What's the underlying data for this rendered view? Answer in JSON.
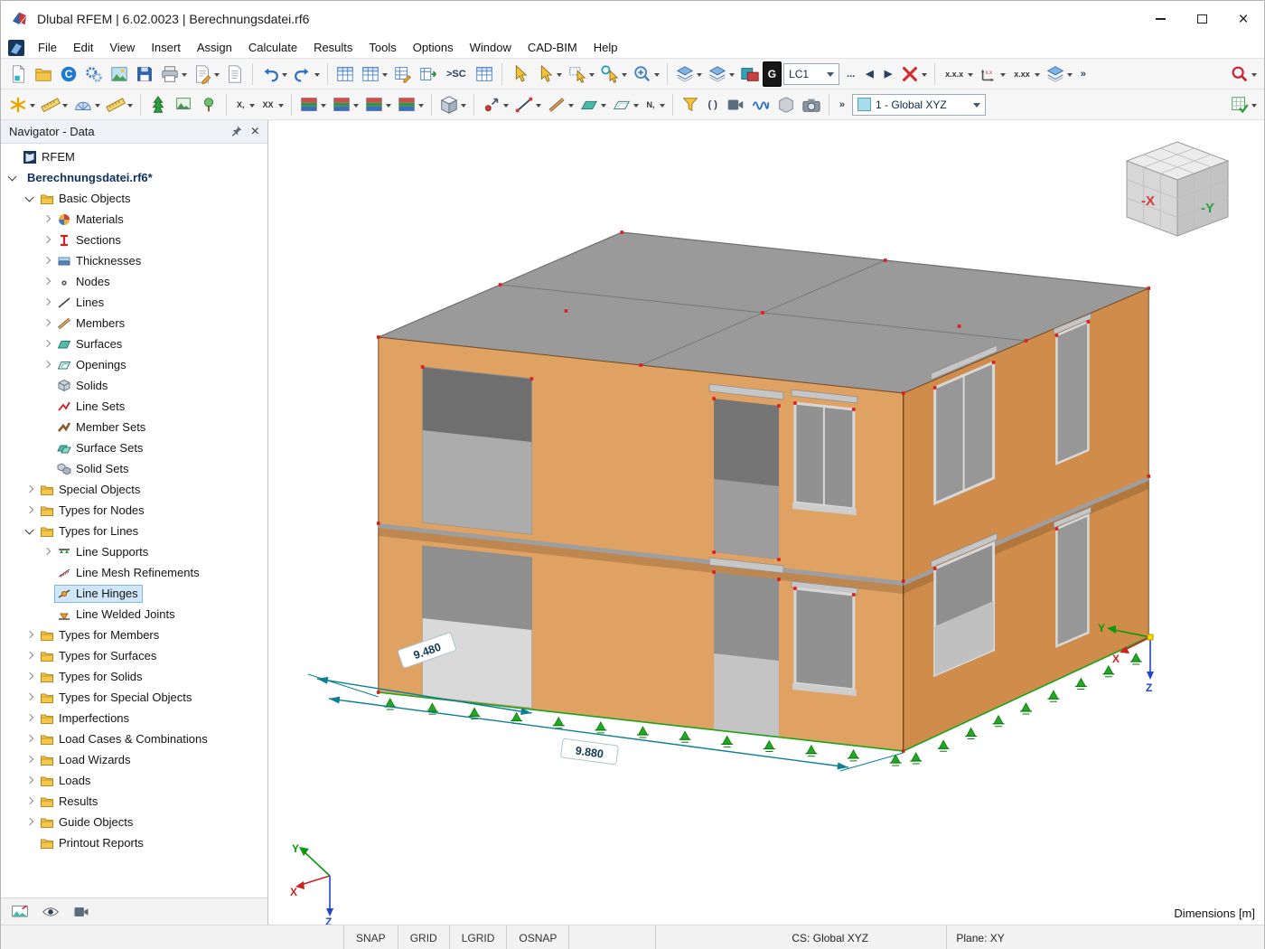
{
  "window": {
    "title": "Dlubal RFEM | 6.02.0023 | Berechnungsdatei.rf6",
    "minimize_glyph": "–",
    "maximize_glyph": "□",
    "close_glyph": "×"
  },
  "menu": {
    "items": [
      "File",
      "Edit",
      "View",
      "Insert",
      "Assign",
      "Calculate",
      "Results",
      "Tools",
      "Options",
      "Window",
      "CAD-BIM",
      "Help"
    ]
  },
  "toolbars": {
    "row1": [
      {
        "name": "new-model-button",
        "icon": "page"
      },
      {
        "name": "open-model-button",
        "icon": "folder"
      },
      {
        "name": "dlubal-center-button",
        "icon": "globec"
      },
      {
        "name": "settings-button",
        "icon": "gears"
      },
      {
        "name": "panel-manager-button",
        "icon": "render"
      },
      {
        "name": "save-button",
        "icon": "floppy"
      },
      {
        "name": "print-button",
        "icon": "printer",
        "dd": 1
      },
      {
        "name": "printout-report-button",
        "icon": "docpen",
        "dd": 1
      },
      {
        "name": "report-button",
        "icon": "doc"
      },
      {
        "sep": 1
      },
      {
        "name": "undo-button",
        "icon": "undo",
        "dd": 1
      },
      {
        "name": "redo-button",
        "icon": "redo",
        "dd": 1
      },
      {
        "sep": 1
      },
      {
        "name": "show-tables-button",
        "icon": "table"
      },
      {
        "name": "table-layout-button",
        "icon": "table",
        "dd": 1
      },
      {
        "name": "edit-table-button",
        "icon": "tablepen"
      },
      {
        "name": "export-table-button",
        "icon": "tablearr"
      },
      {
        "name": "sc-shortcut-button",
        "text": ">SC"
      },
      {
        "name": "table-settings-button",
        "icon": "table"
      },
      {
        "sep": 1
      },
      {
        "name": "select-pointer-button",
        "icon": "cursor"
      },
      {
        "name": "select-special-button",
        "icon": "cursor",
        "dd": 1
      },
      {
        "name": "select-window-button",
        "icon": "cursorwin",
        "dd": 1
      },
      {
        "name": "select-criteria-button",
        "icon": "cursorq",
        "dd": 1
      },
      {
        "name": "zoom-window-button",
        "icon": "magplus",
        "dd": 1
      },
      {
        "sep": 1
      },
      {
        "name": "guide-lines-button",
        "icon": "layers",
        "dd": 1
      },
      {
        "name": "snap-grid-button",
        "icon": "layers",
        "dd": 1
      },
      {
        "name": "partial-view-swatch-button",
        "icon": "swatch"
      },
      {
        "name": "g-grid-toggle-button",
        "text": "G",
        "style": "gbox"
      },
      {
        "name": "load-case-select",
        "select": "LC1",
        "width": 62
      },
      {
        "name": "load-case-browse-button",
        "text": "..."
      },
      {
        "name": "previous-load-case-button",
        "text": "◀"
      },
      {
        "name": "next-load-case-button",
        "text": "▶"
      },
      {
        "name": "delete-loads-button",
        "icon": "xred",
        "dd": 1
      },
      {
        "sep": 1
      },
      {
        "name": "numbering-nodes-button",
        "text": "x.x.x",
        "small": 1,
        "dd": 1
      },
      {
        "name": "numbering-axes-button",
        "icon": "axes",
        "dd": 1
      },
      {
        "name": "numbering-values-button",
        "text": "x.xx",
        "small": 1,
        "dd": 1
      },
      {
        "name": "display-layers-button",
        "icon": "layers",
        "dd": 1
      },
      {
        "name": "toolbar-overflow-1-button",
        "text": "»"
      },
      {
        "spacer": 1
      },
      {
        "name": "find-object-button",
        "icon": "magred",
        "dd": 1
      }
    ],
    "row2": [
      {
        "name": "new-objects-button",
        "icon": "star",
        "dd": 1
      },
      {
        "name": "edit-objects-button",
        "icon": "ruler",
        "dd": 1
      },
      {
        "name": "measure-button",
        "icon": "protract",
        "dd": 1
      },
      {
        "name": "generate-button",
        "icon": "ruler",
        "dd": 1
      },
      {
        "sep": 1
      },
      {
        "name": "guide-objects-button",
        "icon": "tree"
      },
      {
        "name": "background-image-button",
        "icon": "tree2"
      },
      {
        "name": "visual-style-button",
        "icon": "tree3"
      },
      {
        "sep": 1
      },
      {
        "name": "numbering-x-button",
        "text": "X,",
        "small": 1,
        "dd": 1
      },
      {
        "name": "numbering-xx-button",
        "text": "XX",
        "small": 1,
        "dd": 1
      },
      {
        "sep": 1
      },
      {
        "name": "display-results-button",
        "icon": "renderc",
        "dd": 1
      },
      {
        "name": "render-solid-button",
        "icon": "renderc",
        "dd": 1
      },
      {
        "name": "render-transparent-button",
        "icon": "renderc",
        "dd": 1
      },
      {
        "name": "render-wireframe-button",
        "icon": "renderc",
        "dd": 1
      },
      {
        "sep": 1
      },
      {
        "name": "isometric-view-button",
        "icon": "cube",
        "dd": 1
      },
      {
        "sep": 1
      },
      {
        "name": "insert-node-button",
        "icon": "node",
        "dd": 1
      },
      {
        "name": "insert-line-button",
        "icon": "linei",
        "dd": 1
      },
      {
        "name": "insert-member-button",
        "icon": "memberi",
        "dd": 1
      },
      {
        "name": "insert-surface-button",
        "icon": "surfi",
        "dd": 1
      },
      {
        "name": "insert-opening-button",
        "icon": "openi",
        "dd": 1
      },
      {
        "name": "numbering-n-button",
        "text": "N,",
        "small": 1,
        "dd": 1
      },
      {
        "sep": 1
      },
      {
        "name": "visibility-filter-button",
        "icon": "funnel"
      },
      {
        "name": "clipping-box-button",
        "text": "( )"
      },
      {
        "name": "render-video-button",
        "icon": "film"
      },
      {
        "name": "influence-line-button",
        "icon": "wave"
      },
      {
        "name": "ghost-model-button",
        "icon": "ghost"
      },
      {
        "name": "camera-view-button",
        "icon": "camera"
      },
      {
        "sep": 1
      },
      {
        "name": "toolbar-overflow-2-button",
        "text": "»"
      },
      {
        "name": "work-plane-select",
        "select": "1 - Global XYZ",
        "width": 148,
        "lead": 1
      },
      {
        "spacer": 1
      },
      {
        "name": "mesh-settings-button",
        "icon": "gridcheck",
        "dd": 1
      }
    ]
  },
  "navigator": {
    "title": "Navigator - Data",
    "tree": [
      {
        "lvl": 0,
        "label": "RFEM",
        "icon": "rfem",
        "chev": "none"
      },
      {
        "lvl": 0,
        "label": "Berechnungsdatei.rf6*",
        "chev": "down",
        "bold": 1
      },
      {
        "lvl": 1,
        "label": "Basic Objects",
        "icon": "folder",
        "chev": "down"
      },
      {
        "lvl": 2,
        "label": "Materials",
        "icon": "materials",
        "chev": "right"
      },
      {
        "lvl": 2,
        "label": "Sections",
        "icon": "sections",
        "chev": "right"
      },
      {
        "lvl": 2,
        "label": "Thicknesses",
        "icon": "thickness",
        "chev": "right"
      },
      {
        "lvl": 2,
        "label": "Nodes",
        "icon": "nodes",
        "chev": "right"
      },
      {
        "lvl": 2,
        "label": "Lines",
        "icon": "lines",
        "chev": "right"
      },
      {
        "lvl": 2,
        "label": "Members",
        "icon": "members",
        "chev": "right"
      },
      {
        "lvl": 2,
        "label": "Surfaces",
        "icon": "surfaces",
        "chev": "right"
      },
      {
        "lvl": 2,
        "label": "Openings",
        "icon": "openings",
        "chev": "right"
      },
      {
        "lvl": 2,
        "label": "Solids",
        "icon": "solids",
        "chev": "none"
      },
      {
        "lvl": 2,
        "label": "Line Sets",
        "icon": "linesets",
        "chev": "none"
      },
      {
        "lvl": 2,
        "label": "Member Sets",
        "icon": "membersets",
        "chev": "none"
      },
      {
        "lvl": 2,
        "label": "Surface Sets",
        "icon": "surfacesets",
        "chev": "none"
      },
      {
        "lvl": 2,
        "label": "Solid Sets",
        "icon": "solidsets",
        "chev": "none"
      },
      {
        "lvl": 1,
        "label": "Special Objects",
        "icon": "folder",
        "chev": "right"
      },
      {
        "lvl": 1,
        "label": "Types for Nodes",
        "icon": "folder",
        "chev": "right"
      },
      {
        "lvl": 1,
        "label": "Types for Lines",
        "icon": "folder",
        "chev": "down"
      },
      {
        "lvl": 2,
        "label": "Line Supports",
        "icon": "linesupports",
        "chev": "right"
      },
      {
        "lvl": 2,
        "label": "Line Mesh Refinements",
        "icon": "linemesh",
        "chev": "none"
      },
      {
        "lvl": 2,
        "label": "Line Hinges",
        "icon": "linehinges",
        "chev": "none",
        "selected": 1
      },
      {
        "lvl": 2,
        "label": "Line Welded Joints",
        "icon": "linewelds",
        "chev": "none"
      },
      {
        "lvl": 1,
        "label": "Types for Members",
        "icon": "folder",
        "chev": "right"
      },
      {
        "lvl": 1,
        "label": "Types for Surfaces",
        "icon": "folder",
        "chev": "right"
      },
      {
        "lvl": 1,
        "label": "Types for Solids",
        "icon": "folder",
        "chev": "right"
      },
      {
        "lvl": 1,
        "label": "Types for Special Objects",
        "icon": "folder",
        "chev": "right"
      },
      {
        "lvl": 1,
        "label": "Imperfections",
        "icon": "folder",
        "chev": "right"
      },
      {
        "lvl": 1,
        "label": "Load Cases & Combinations",
        "icon": "folder",
        "chev": "right"
      },
      {
        "lvl": 1,
        "label": "Load Wizards",
        "icon": "folder",
        "chev": "right"
      },
      {
        "lvl": 1,
        "label": "Loads",
        "icon": "folder",
        "chev": "right"
      },
      {
        "lvl": 1,
        "label": "Results",
        "icon": "folder",
        "chev": "right"
      },
      {
        "lvl": 1,
        "label": "Guide Objects",
        "icon": "folder",
        "chev": "right"
      },
      {
        "lvl": 1,
        "label": "Printout Reports",
        "icon": "folder",
        "chev": "none"
      }
    ],
    "tabs": [
      {
        "name": "tab-data",
        "icon": "panelimg"
      },
      {
        "name": "tab-display",
        "icon": "eye"
      },
      {
        "name": "tab-views",
        "icon": "film"
      }
    ]
  },
  "viewport": {
    "dim_a": "9.480",
    "dim_b": "9.880",
    "dimensions_note": "Dimensions [m]",
    "view_cube": {
      "front_face": "-X",
      "side_face": "-Y"
    },
    "axes": {
      "x": "X",
      "y": "Y",
      "z": "Z"
    },
    "colors": {
      "wall_left": "#dfa263",
      "wall_right": "#cf8c4b",
      "roof": "#9a9a9a",
      "support_green": "#22a822",
      "dimension_teal": "#0b7f93",
      "node_red": "#e01b1b",
      "selection_blue": "#cfe7f8"
    }
  },
  "statusbar": {
    "toggles": [
      "SNAP",
      "GRID",
      "LGRID",
      "OSNAP"
    ],
    "cs": "CS: Global XYZ",
    "plane": "Plane: XY"
  }
}
